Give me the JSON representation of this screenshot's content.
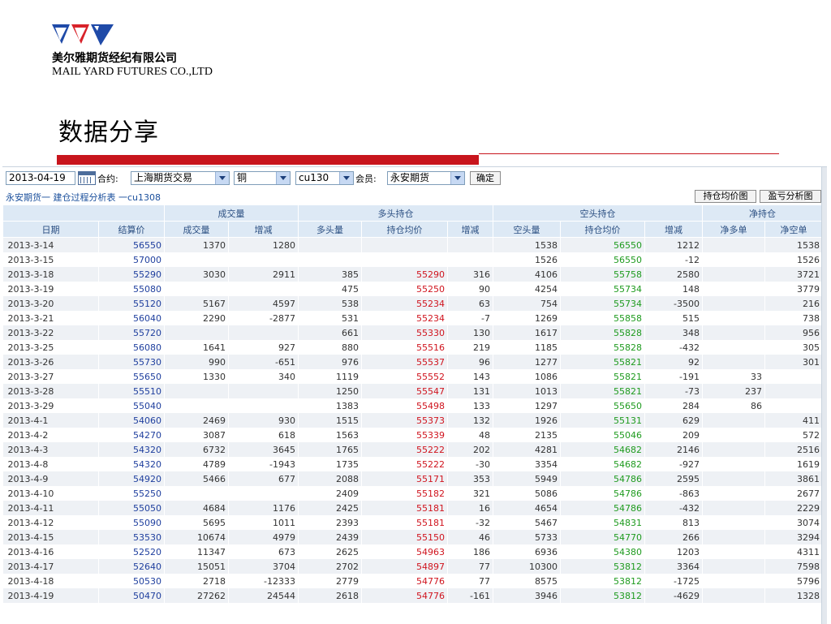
{
  "brand": {
    "name_cn": "美尔雅期货经纪有限公司",
    "name_en": "MAIL YARD FUTURES CO.,LTD",
    "logo_icon": "company-logo-icon",
    "colors": {
      "accent": "#c8151d",
      "logo_blue": "#1f4aa8",
      "logo_red": "#d8222a"
    }
  },
  "slide": {
    "title": "数据分享"
  },
  "toolbar": {
    "date": "2013-04-19",
    "contract_label": "合约:",
    "exchange": "上海期货交易",
    "product": "铜",
    "contract": "cu130",
    "member_label": "会员:",
    "member": "永安期货",
    "confirm_label": "确定"
  },
  "subbar": {
    "title": "永安期货一 建仓过程分析表 一cu1308",
    "btn_avg_chart": "持仓均价图",
    "btn_pnl_chart": "盈亏分析图"
  },
  "table": {
    "groups": {
      "volume": "成交量",
      "long": "多头持仓",
      "short": "空头持仓",
      "net": "净持仓"
    },
    "headers": [
      "日期",
      "结算价",
      "成交量",
      "增减",
      "多头量",
      "持仓均价",
      "增减",
      "空头量",
      "持仓均价",
      "增减",
      "净多单",
      "净空单"
    ],
    "rows": [
      [
        "2013-3-14",
        "56550",
        "1370",
        "1280",
        "",
        "",
        "",
        "1538",
        "56550",
        "1212",
        "",
        "1538"
      ],
      [
        "2013-3-15",
        "57000",
        "",
        "",
        "",
        "",
        "",
        "1526",
        "56550",
        "-12",
        "",
        "1526"
      ],
      [
        "2013-3-18",
        "55290",
        "3030",
        "2911",
        "385",
        "55290",
        "316",
        "4106",
        "55758",
        "2580",
        "",
        "3721"
      ],
      [
        "2013-3-19",
        "55080",
        "",
        "",
        "475",
        "55250",
        "90",
        "4254",
        "55734",
        "148",
        "",
        "3779"
      ],
      [
        "2013-3-20",
        "55120",
        "5167",
        "4597",
        "538",
        "55234",
        "63",
        "754",
        "55734",
        "-3500",
        "",
        "216"
      ],
      [
        "2013-3-21",
        "56040",
        "2290",
        "-2877",
        "531",
        "55234",
        "-7",
        "1269",
        "55858",
        "515",
        "",
        "738"
      ],
      [
        "2013-3-22",
        "55720",
        "",
        "",
        "661",
        "55330",
        "130",
        "1617",
        "55828",
        "348",
        "",
        "956"
      ],
      [
        "2013-3-25",
        "56080",
        "1641",
        "927",
        "880",
        "55516",
        "219",
        "1185",
        "55828",
        "-432",
        "",
        "305"
      ],
      [
        "2013-3-26",
        "55730",
        "990",
        "-651",
        "976",
        "55537",
        "96",
        "1277",
        "55821",
        "92",
        "",
        "301"
      ],
      [
        "2013-3-27",
        "55650",
        "1330",
        "340",
        "1119",
        "55552",
        "143",
        "1086",
        "55821",
        "-191",
        "33",
        ""
      ],
      [
        "2013-3-28",
        "55510",
        "",
        "",
        "1250",
        "55547",
        "131",
        "1013",
        "55821",
        "-73",
        "237",
        ""
      ],
      [
        "2013-3-29",
        "55040",
        "",
        "",
        "1383",
        "55498",
        "133",
        "1297",
        "55650",
        "284",
        "86",
        ""
      ],
      [
        "2013-4-1",
        "54060",
        "2469",
        "930",
        "1515",
        "55373",
        "132",
        "1926",
        "55131",
        "629",
        "",
        "411"
      ],
      [
        "2013-4-2",
        "54270",
        "3087",
        "618",
        "1563",
        "55339",
        "48",
        "2135",
        "55046",
        "209",
        "",
        "572"
      ],
      [
        "2013-4-3",
        "54320",
        "6732",
        "3645",
        "1765",
        "55222",
        "202",
        "4281",
        "54682",
        "2146",
        "",
        "2516"
      ],
      [
        "2013-4-8",
        "54320",
        "4789",
        "-1943",
        "1735",
        "55222",
        "-30",
        "3354",
        "54682",
        "-927",
        "",
        "1619"
      ],
      [
        "2013-4-9",
        "54920",
        "5466",
        "677",
        "2088",
        "55171",
        "353",
        "5949",
        "54786",
        "2595",
        "",
        "3861"
      ],
      [
        "2013-4-10",
        "55250",
        "",
        "",
        "2409",
        "55182",
        "321",
        "5086",
        "54786",
        "-863",
        "",
        "2677"
      ],
      [
        "2013-4-11",
        "55050",
        "4684",
        "1176",
        "2425",
        "55181",
        "16",
        "4654",
        "54786",
        "-432",
        "",
        "2229"
      ],
      [
        "2013-4-12",
        "55090",
        "5695",
        "1011",
        "2393",
        "55181",
        "-32",
        "5467",
        "54831",
        "813",
        "",
        "3074"
      ],
      [
        "2013-4-15",
        "53530",
        "10674",
        "4979",
        "2439",
        "55150",
        "46",
        "5733",
        "54770",
        "266",
        "",
        "3294"
      ],
      [
        "2013-4-16",
        "52520",
        "11347",
        "673",
        "2625",
        "54963",
        "186",
        "6936",
        "54380",
        "1203",
        "",
        "4311"
      ],
      [
        "2013-4-17",
        "52640",
        "15051",
        "3704",
        "2702",
        "54897",
        "77",
        "10300",
        "53812",
        "3364",
        "",
        "7598"
      ],
      [
        "2013-4-18",
        "50530",
        "2718",
        "-12333",
        "2779",
        "54776",
        "77",
        "8575",
        "53812",
        "-1725",
        "",
        "5796"
      ],
      [
        "2013-4-19",
        "50470",
        "27262",
        "24544",
        "2618",
        "54776",
        "-161",
        "3946",
        "53812",
        "-4629",
        "",
        "1328"
      ]
    ]
  }
}
